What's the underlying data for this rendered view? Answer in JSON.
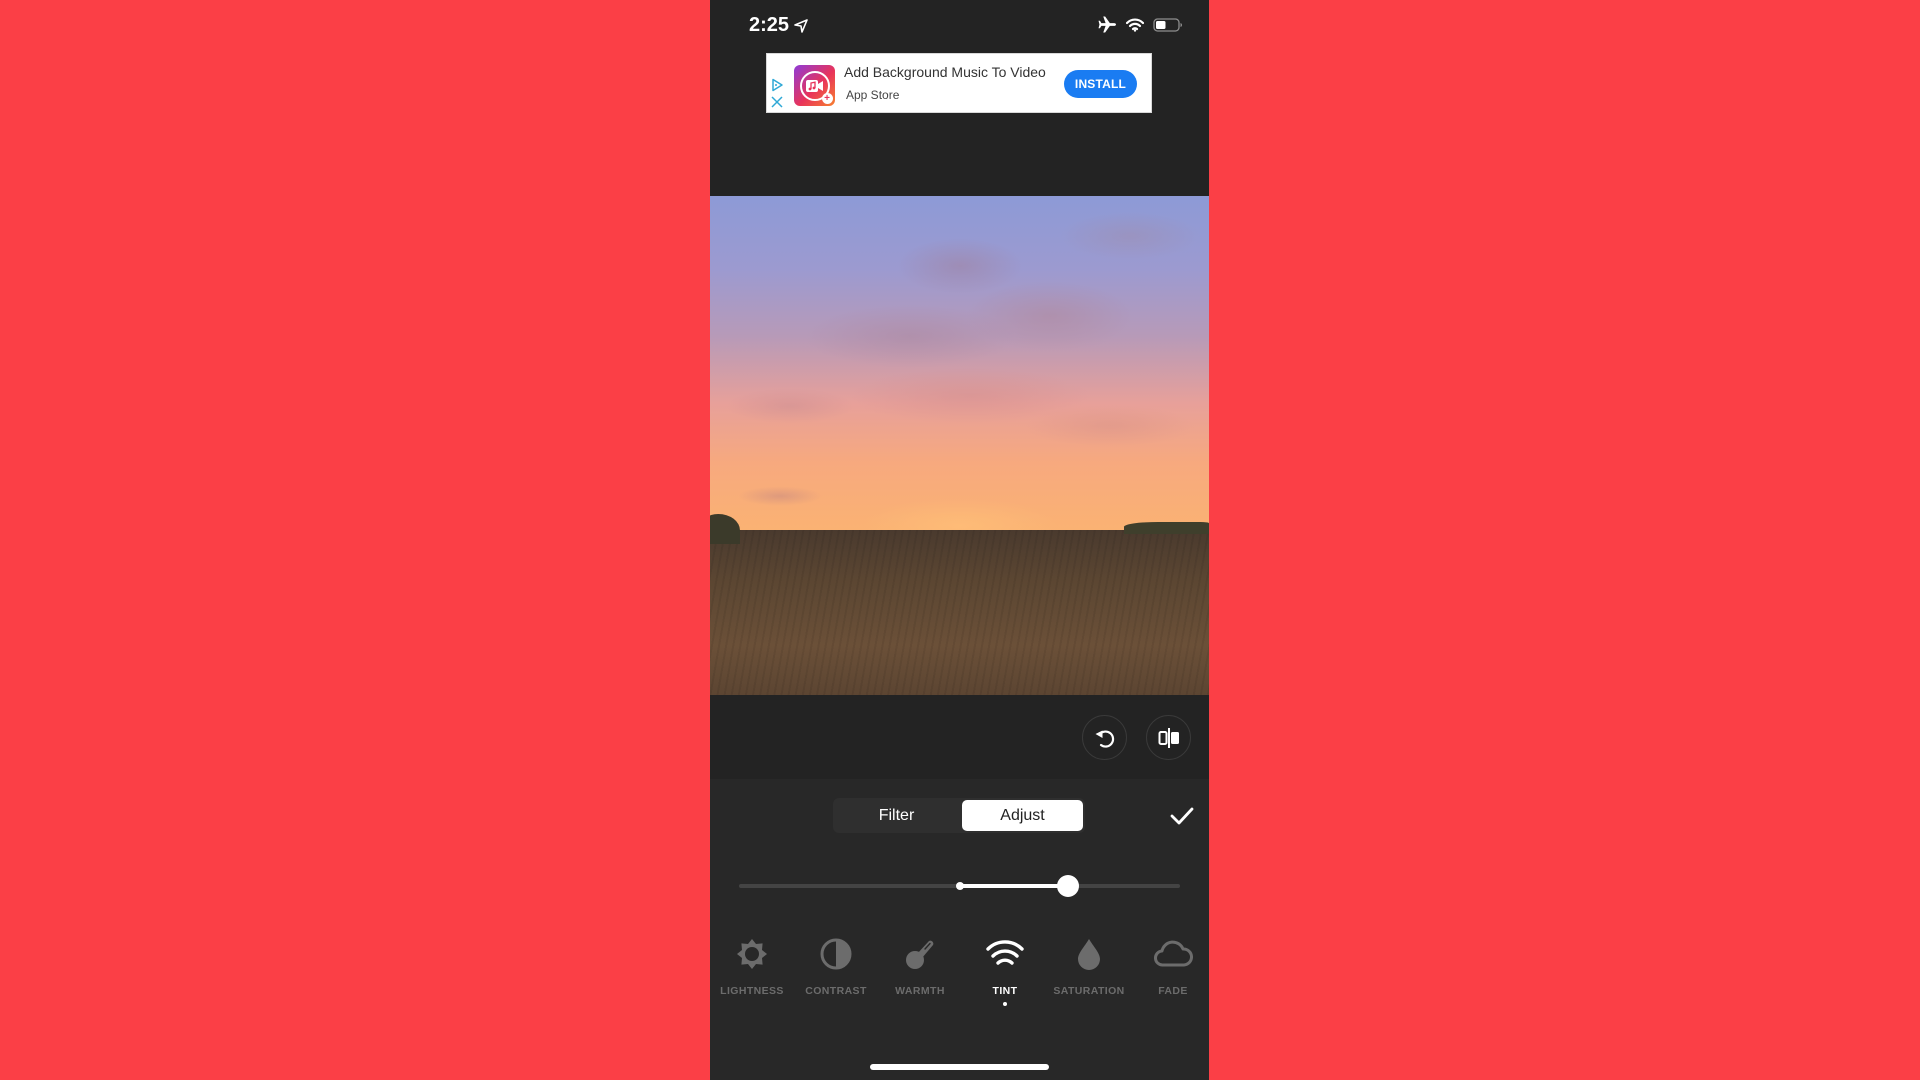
{
  "status_bar": {
    "time": "2:25",
    "icons": [
      "location-arrow-icon",
      "airplane-mode-icon",
      "wifi-icon",
      "battery-icon"
    ],
    "battery_level": 0.45
  },
  "ad": {
    "title": "Add Background Music To Video",
    "subtitle": "App Store",
    "install_label": "INSTALL",
    "icons": [
      "ad-choices-icon",
      "ad-close-icon",
      "app-icon"
    ],
    "accent_color": "#1a7cf2"
  },
  "photo": {
    "description": "Sunset over wheat field with pink/purple clouds"
  },
  "photo_actions": {
    "rotate_icon": "rotate-icon",
    "compare_icon": "compare-icon"
  },
  "mode_tabs": [
    {
      "label": "Filter",
      "active": false
    },
    {
      "label": "Adjust",
      "active": true
    }
  ],
  "confirm_icon": "checkmark-icon",
  "slider": {
    "min": -100,
    "max": 100,
    "value": 49
  },
  "tools": [
    {
      "label": "LIGHTNESS",
      "icon": "sun-icon",
      "active": false
    },
    {
      "label": "CONTRAST",
      "icon": "contrast-icon",
      "active": false
    },
    {
      "label": "WARMTH",
      "icon": "thermometer-icon",
      "active": false
    },
    {
      "label": "TINT",
      "icon": "tint-waves-icon",
      "active": true
    },
    {
      "label": "SATURATION",
      "icon": "droplet-icon",
      "active": false
    },
    {
      "label": "FADE",
      "icon": "cloud-icon",
      "active": false
    }
  ],
  "colors": {
    "background": "#fb3f46",
    "phone_bg": "#232323",
    "panel_bg": "#282828",
    "inactive_tool": "#6c6c6c"
  }
}
